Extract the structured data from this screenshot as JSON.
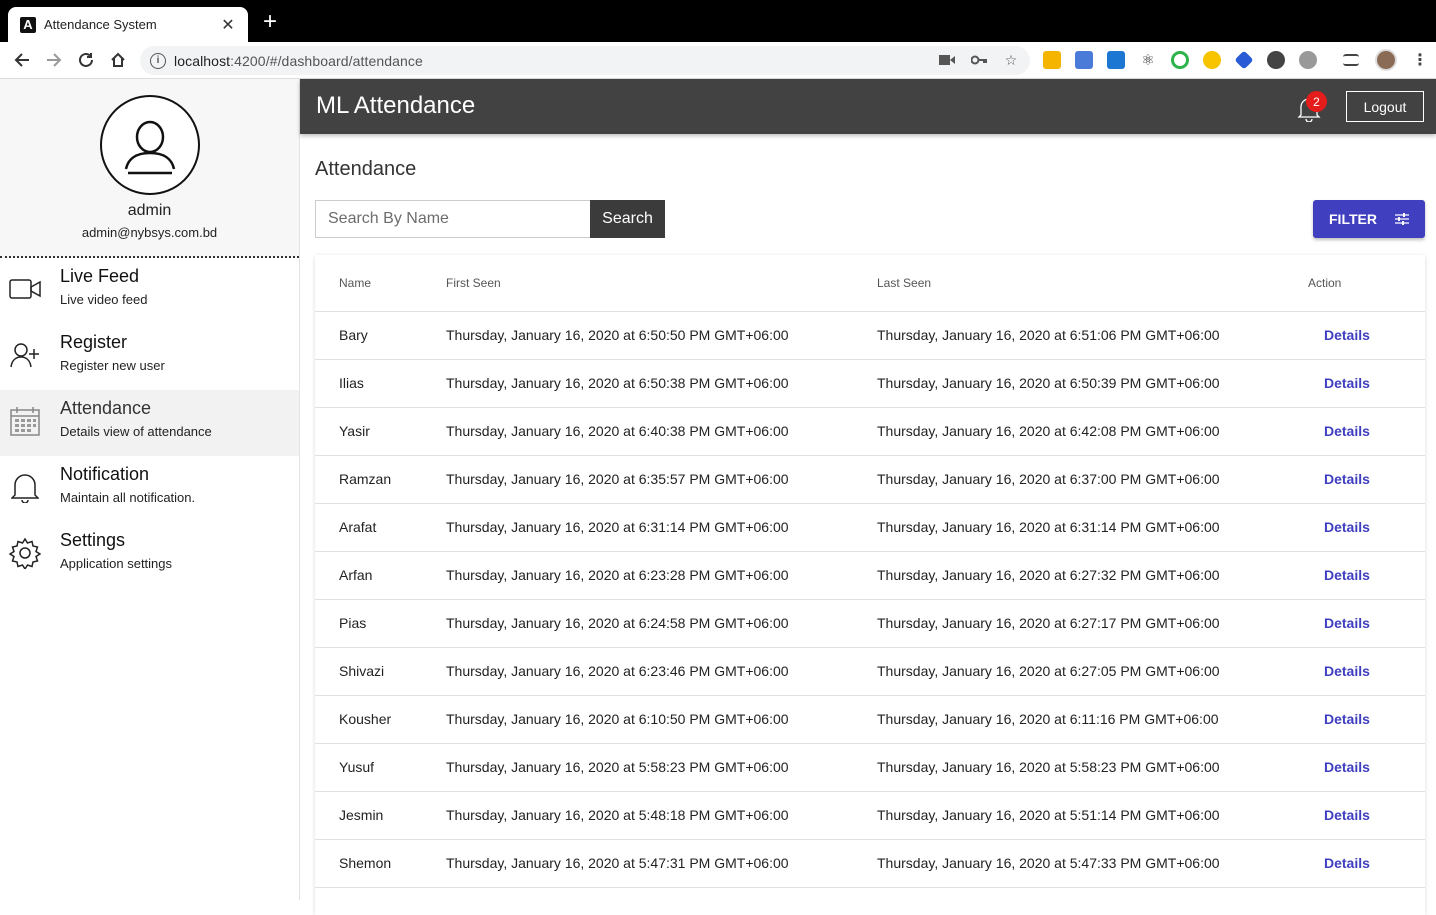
{
  "browser": {
    "tab_title": "Attendance System",
    "url_host": "localhost",
    "url_rest": ":4200/#/dashboard/attendance"
  },
  "sidebar": {
    "user_name": "admin",
    "user_email": "admin@nybsys.com.bd",
    "items": [
      {
        "title": "Live Feed",
        "subtitle": "Live video feed",
        "icon": "video-camera-icon"
      },
      {
        "title": "Register",
        "subtitle": "Register new user",
        "icon": "add-user-icon"
      },
      {
        "title": "Attendance",
        "subtitle": "Details view of attendance",
        "icon": "calendar-icon",
        "active": true
      },
      {
        "title": "Notification",
        "subtitle": "Maintain all notification.",
        "icon": "bell-icon"
      },
      {
        "title": "Settings",
        "subtitle": "Application settings",
        "icon": "gear-icon"
      }
    ]
  },
  "header": {
    "title": "ML Attendance",
    "notification_count": "2",
    "logout_label": "Logout"
  },
  "main": {
    "page_title": "Attendance",
    "search_placeholder": "Search By Name",
    "search_label": "Search",
    "filter_label": "FILTER"
  },
  "table": {
    "columns": [
      "Name",
      "First Seen",
      "Last Seen",
      "Action"
    ],
    "rows": [
      {
        "name": "Bary",
        "first": "Thursday, January 16, 2020 at 6:50:50 PM GMT+06:00",
        "last": "Thursday, January 16, 2020 at 6:51:06 PM GMT+06:00",
        "action": "Details"
      },
      {
        "name": "Ilias",
        "first": "Thursday, January 16, 2020 at 6:50:38 PM GMT+06:00",
        "last": "Thursday, January 16, 2020 at 6:50:39 PM GMT+06:00",
        "action": "Details"
      },
      {
        "name": "Yasir",
        "first": "Thursday, January 16, 2020 at 6:40:38 PM GMT+06:00",
        "last": "Thursday, January 16, 2020 at 6:42:08 PM GMT+06:00",
        "action": "Details"
      },
      {
        "name": "Ramzan",
        "first": "Thursday, January 16, 2020 at 6:35:57 PM GMT+06:00",
        "last": "Thursday, January 16, 2020 at 6:37:00 PM GMT+06:00",
        "action": "Details"
      },
      {
        "name": "Arafat",
        "first": "Thursday, January 16, 2020 at 6:31:14 PM GMT+06:00",
        "last": "Thursday, January 16, 2020 at 6:31:14 PM GMT+06:00",
        "action": "Details"
      },
      {
        "name": "Arfan",
        "first": "Thursday, January 16, 2020 at 6:23:28 PM GMT+06:00",
        "last": "Thursday, January 16, 2020 at 6:27:32 PM GMT+06:00",
        "action": "Details"
      },
      {
        "name": "Pias",
        "first": "Thursday, January 16, 2020 at 6:24:58 PM GMT+06:00",
        "last": "Thursday, January 16, 2020 at 6:27:17 PM GMT+06:00",
        "action": "Details"
      },
      {
        "name": "Shivazi",
        "first": "Thursday, January 16, 2020 at 6:23:46 PM GMT+06:00",
        "last": "Thursday, January 16, 2020 at 6:27:05 PM GMT+06:00",
        "action": "Details"
      },
      {
        "name": "Kousher",
        "first": "Thursday, January 16, 2020 at 6:10:50 PM GMT+06:00",
        "last": "Thursday, January 16, 2020 at 6:11:16 PM GMT+06:00",
        "action": "Details"
      },
      {
        "name": "Yusuf",
        "first": "Thursday, January 16, 2020 at 5:58:23 PM GMT+06:00",
        "last": "Thursday, January 16, 2020 at 5:58:23 PM GMT+06:00",
        "action": "Details"
      },
      {
        "name": "Jesmin",
        "first": "Thursday, January 16, 2020 at 5:48:18 PM GMT+06:00",
        "last": "Thursday, January 16, 2020 at 5:51:14 PM GMT+06:00",
        "action": "Details"
      },
      {
        "name": "Shemon",
        "first": "Thursday, January 16, 2020 at 5:47:31 PM GMT+06:00",
        "last": "Thursday, January 16, 2020 at 5:47:33 PM GMT+06:00",
        "action": "Details"
      }
    ]
  },
  "colors": {
    "accent": "#3f3fbf",
    "appbar": "#424242",
    "badge": "#e41c1c"
  }
}
